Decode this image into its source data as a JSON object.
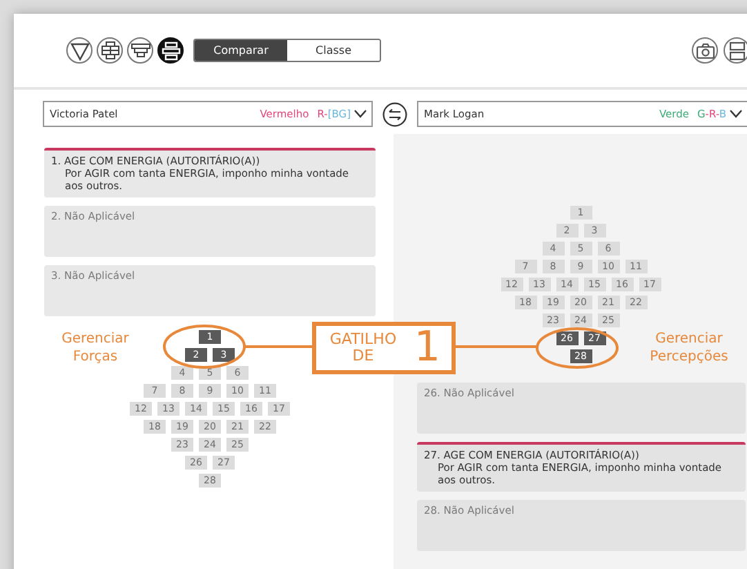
{
  "toolbar": {
    "view_buttons": [
      {
        "kind": "triangle",
        "selected": false
      },
      {
        "kind": "bricks",
        "selected": false
      },
      {
        "kind": "tee",
        "selected": false
      },
      {
        "kind": "stack",
        "selected": true
      }
    ],
    "mode_tabs": [
      {
        "label": "Comparar",
        "selected": true
      },
      {
        "label": "Classe",
        "selected": false
      }
    ]
  },
  "selectors": [
    {
      "name": "Victoria Patel",
      "color_name": "Vermelho",
      "color": "#e0457b",
      "code": [
        {
          "text": "R-",
          "color": "#e0457b"
        },
        {
          "text": "[BG]",
          "color": "#6ab7de"
        }
      ]
    },
    {
      "name": "Mark Logan",
      "color_name": "Verde",
      "color": "#3aaa74",
      "code": [
        {
          "text": "G",
          "color": "#3aaa74"
        },
        {
          "text": "-R-",
          "color": "#e0457b"
        },
        {
          "text": "B",
          "color": "#6ab7de"
        }
      ]
    }
  ],
  "left_panel": {
    "cards": [
      {
        "kind": "statement",
        "title": "1. AGE COM ENERGIA (AUTORITÁRIO(A))",
        "text": "Por AGIR com tanta ENERGIA, imponho minha vontade aos outros."
      },
      {
        "kind": "empty",
        "title": "2. Não Aplicável"
      },
      {
        "kind": "empty",
        "title": "3. Não Aplicável"
      }
    ],
    "pyramid": [
      [
        {
          "label": "1",
          "highlighted": true
        }
      ],
      [
        {
          "label": "2",
          "highlighted": true
        },
        {
          "label": "3",
          "highlighted": true
        }
      ],
      [
        {
          "label": "4",
          "highlighted": false
        },
        {
          "label": "5",
          "highlighted": false
        },
        {
          "label": "6",
          "highlighted": false
        }
      ],
      [
        {
          "label": "7",
          "highlighted": false
        },
        {
          "label": "8",
          "highlighted": false
        },
        {
          "label": "9",
          "highlighted": false
        },
        {
          "label": "10",
          "highlighted": false
        },
        {
          "label": "11",
          "highlighted": false
        }
      ],
      [
        {
          "label": "12",
          "highlighted": false
        },
        {
          "label": "13",
          "highlighted": false
        },
        {
          "label": "14",
          "highlighted": false
        },
        {
          "label": "15",
          "highlighted": false
        },
        {
          "label": "16",
          "highlighted": false
        },
        {
          "label": "17",
          "highlighted": false
        }
      ],
      [
        {
          "label": "18",
          "highlighted": false
        },
        {
          "label": "19",
          "highlighted": false
        },
        {
          "label": "20",
          "highlighted": false
        },
        {
          "label": "21",
          "highlighted": false
        },
        {
          "label": "22",
          "highlighted": false
        }
      ],
      [
        {
          "label": "23",
          "highlighted": false
        },
        {
          "label": "24",
          "highlighted": false
        },
        {
          "label": "25",
          "highlighted": false
        }
      ],
      [
        {
          "label": "26",
          "highlighted": false
        },
        {
          "label": "27",
          "highlighted": false
        }
      ],
      [
        {
          "label": "28",
          "highlighted": false
        }
      ]
    ]
  },
  "right_panel": {
    "pyramid": [
      [
        {
          "label": "1",
          "highlighted": false
        }
      ],
      [
        {
          "label": "2",
          "highlighted": false
        },
        {
          "label": "3",
          "highlighted": false
        }
      ],
      [
        {
          "label": "4",
          "highlighted": false
        },
        {
          "label": "5",
          "highlighted": false
        },
        {
          "label": "6",
          "highlighted": false
        }
      ],
      [
        {
          "label": "7",
          "highlighted": false
        },
        {
          "label": "8",
          "highlighted": false
        },
        {
          "label": "9",
          "highlighted": false
        },
        {
          "label": "10",
          "highlighted": false
        },
        {
          "label": "11",
          "highlighted": false
        }
      ],
      [
        {
          "label": "12",
          "highlighted": false
        },
        {
          "label": "13",
          "highlighted": false
        },
        {
          "label": "14",
          "highlighted": false
        },
        {
          "label": "15",
          "highlighted": false
        },
        {
          "label": "16",
          "highlighted": false
        },
        {
          "label": "17",
          "highlighted": false
        }
      ],
      [
        {
          "label": "18",
          "highlighted": false
        },
        {
          "label": "19",
          "highlighted": false
        },
        {
          "label": "20",
          "highlighted": false
        },
        {
          "label": "21",
          "highlighted": false
        },
        {
          "label": "22",
          "highlighted": false
        }
      ],
      [
        {
          "label": "23",
          "highlighted": false
        },
        {
          "label": "24",
          "highlighted": false
        },
        {
          "label": "25",
          "highlighted": false
        }
      ],
      [
        {
          "label": "26",
          "highlighted": true
        },
        {
          "label": "27",
          "highlighted": true
        }
      ],
      [
        {
          "label": "28",
          "highlighted": true
        }
      ]
    ],
    "cards": [
      {
        "kind": "empty",
        "title": "26. Não Aplicável"
      },
      {
        "kind": "statement",
        "title": "27. AGE COM ENERGIA (AUTORITÁRIO(A))",
        "text": "Por AGIR com tanta ENERGIA, imponho minha vontade aos outros."
      },
      {
        "kind": "empty",
        "title": "28. Não Aplicável"
      }
    ]
  },
  "callout": {
    "left_label": "Gerenciar Forças",
    "title": "GATILHO DE",
    "number": "1",
    "right_label": "Gerenciar Percepções"
  }
}
